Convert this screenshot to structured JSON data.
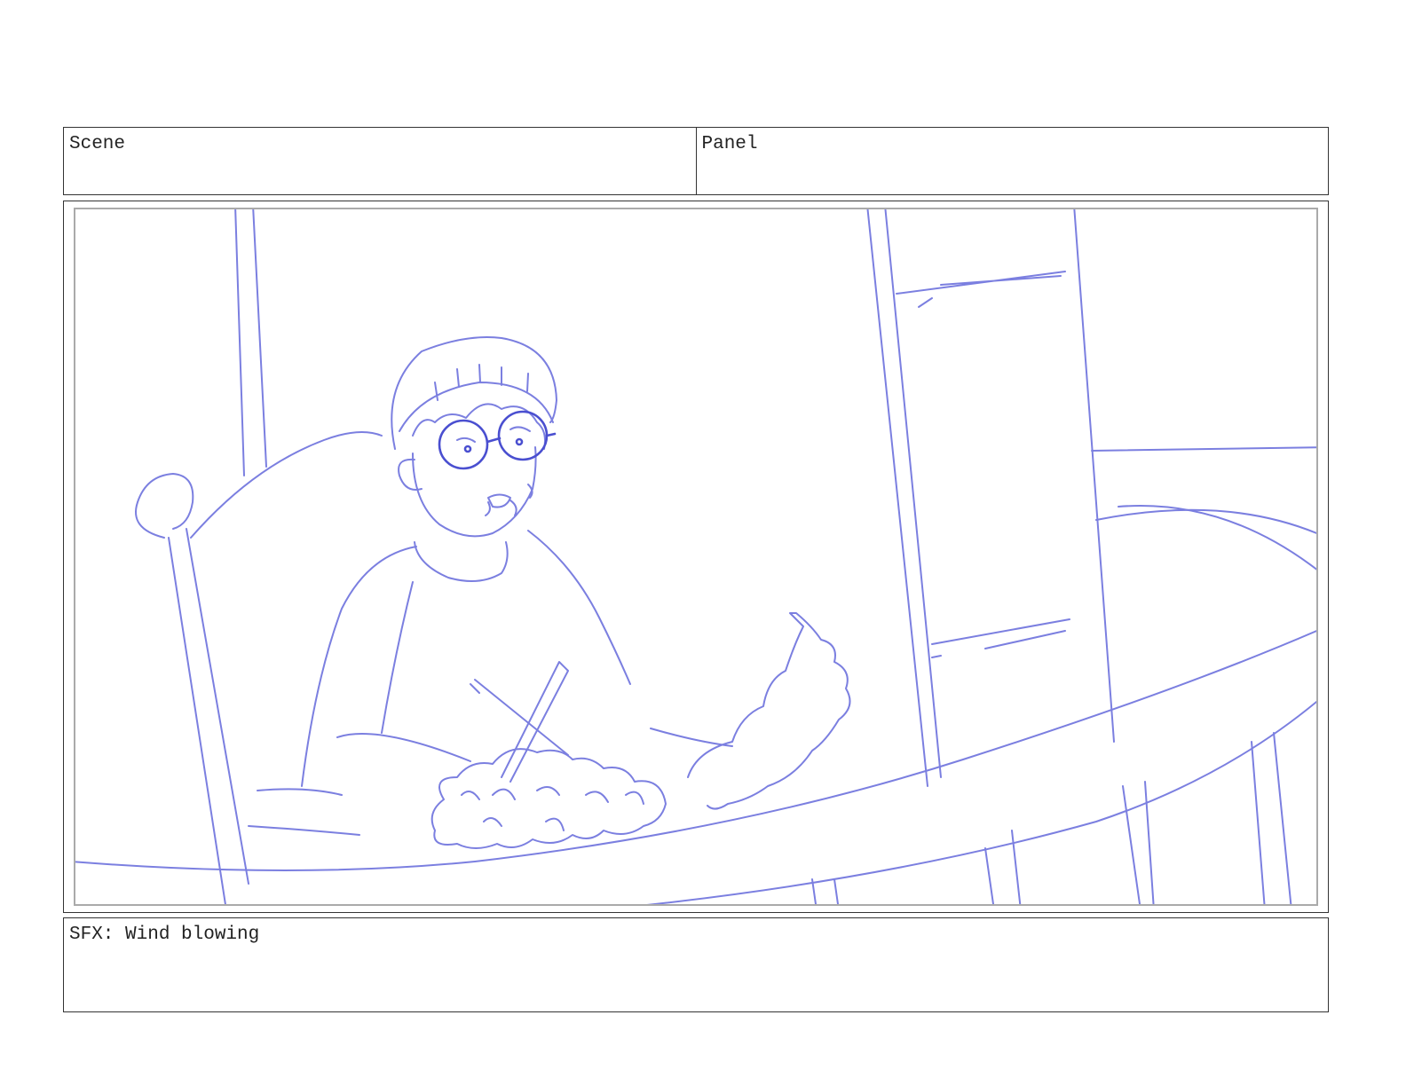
{
  "header": {
    "scene_label": "Scene",
    "panel_label": "Panel"
  },
  "panel": {
    "sketch_color": "#7b7fe0",
    "sketch_dark_color": "#4a4fd0"
  },
  "notes": {
    "text": "SFX: Wind blowing"
  }
}
